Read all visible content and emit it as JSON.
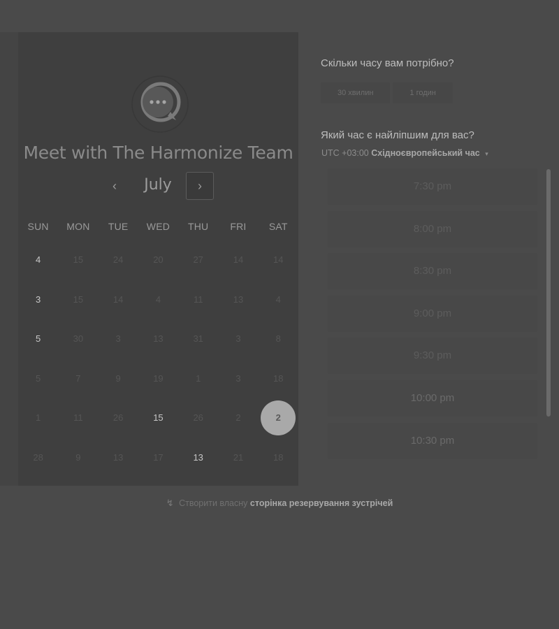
{
  "booking": {
    "title": "Meet with The Harmonize Team",
    "logo_icon": "chat-bubble-icon",
    "month": "July",
    "prev_icon": "‹",
    "next_icon": "›",
    "weekdays": [
      "SUN",
      "MON",
      "TUE",
      "WED",
      "THU",
      "FRI",
      "SAT"
    ],
    "weeks": [
      [
        {
          "d": "4",
          "a": true
        },
        {
          "d": "15",
          "a": false
        },
        {
          "d": "24",
          "a": false
        },
        {
          "d": "20",
          "a": false
        },
        {
          "d": "27",
          "a": false
        },
        {
          "d": "14",
          "a": false
        },
        {
          "d": "14",
          "a": false
        }
      ],
      [
        {
          "d": "3",
          "a": true
        },
        {
          "d": "15",
          "a": false
        },
        {
          "d": "14",
          "a": false
        },
        {
          "d": "4",
          "a": false
        },
        {
          "d": "11",
          "a": false
        },
        {
          "d": "13",
          "a": false
        },
        {
          "d": "4",
          "a": false
        }
      ],
      [
        {
          "d": "5",
          "a": true
        },
        {
          "d": "30",
          "a": false
        },
        {
          "d": "3",
          "a": false
        },
        {
          "d": "13",
          "a": false
        },
        {
          "d": "31",
          "a": false
        },
        {
          "d": "3",
          "a": false
        },
        {
          "d": "8",
          "a": false
        }
      ],
      [
        {
          "d": "5",
          "a": false
        },
        {
          "d": "7",
          "a": false
        },
        {
          "d": "9",
          "a": false
        },
        {
          "d": "19",
          "a": false
        },
        {
          "d": "1",
          "a": false
        },
        {
          "d": "3",
          "a": false
        },
        {
          "d": "18",
          "a": false
        }
      ],
      [
        {
          "d": "1",
          "a": false
        },
        {
          "d": "11",
          "a": false
        },
        {
          "d": "26",
          "a": false
        },
        {
          "d": "15",
          "a": true
        },
        {
          "d": "26",
          "a": false
        },
        {
          "d": "2",
          "a": false
        },
        {
          "d": "2",
          "a": true,
          "selected": true
        }
      ],
      [
        {
          "d": "28",
          "a": false
        },
        {
          "d": "9",
          "a": false
        },
        {
          "d": "13",
          "a": false
        },
        {
          "d": "17",
          "a": false
        },
        {
          "d": "13",
          "a": true
        },
        {
          "d": "21",
          "a": false
        },
        {
          "d": "18",
          "a": false
        }
      ]
    ]
  },
  "duration": {
    "question": "Скільки часу вам потрібно?",
    "options": [
      "30 хвилин",
      "1 годин"
    ]
  },
  "time": {
    "question": "Який час є найліпшим для вас?",
    "tz_offset": "UTC +03:00",
    "tz_name": "Східноєвропейський час",
    "tz_chevron": "▾",
    "slots": [
      "7:30 pm",
      "8:00 pm",
      "8:30 pm",
      "9:00 pm",
      "9:30 pm",
      "10:00 pm",
      "10:30 pm"
    ]
  },
  "footer": {
    "icon": "↯",
    "text": "Створити власну",
    "link": "сторінка резервування зустрічей"
  }
}
